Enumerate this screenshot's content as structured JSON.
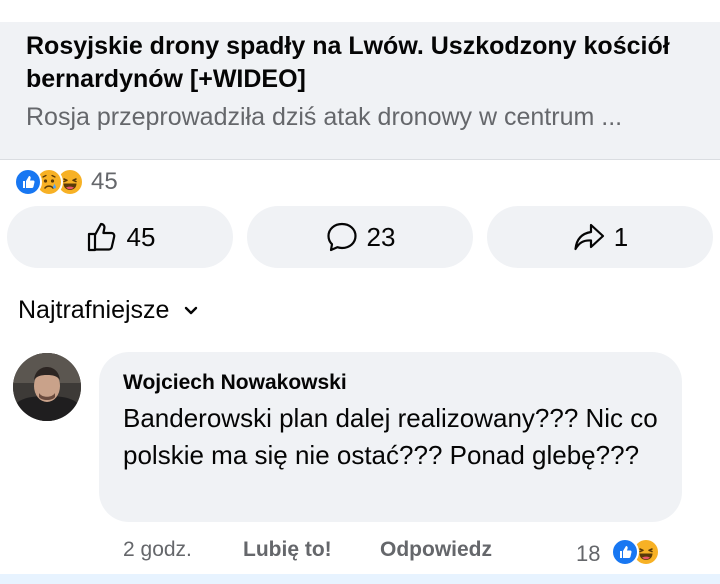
{
  "post": {
    "link_title": "Rosyjskie drony spadły na Lwów. Uszkodzony kościół bernardynów [+WIDEO]",
    "link_description": "Rosja przeprowadziła dziś atak dronowy w centrum ..."
  },
  "reactions": {
    "icons": [
      "like-icon",
      "sad-icon",
      "haha-icon"
    ],
    "count": "45"
  },
  "actions": {
    "like_count": "45",
    "comment_count": "23",
    "share_count": "1"
  },
  "sort": {
    "label": "Najtrafniejsze"
  },
  "comment": {
    "author": "Wojciech Nowakowski",
    "text": "Banderowski plan dalej realizowany??? Nic co polskie ma się nie ostać??? Ponad glebę???",
    "time": "2 godz.",
    "like_label": "Lubię to!",
    "reply_label": "Odpowiedz",
    "reaction_count": "18",
    "reaction_icons": [
      "like-icon",
      "haha-icon"
    ]
  },
  "colors": {
    "like_blue": "#1877f2",
    "emoji_yellow": "#f7b125",
    "bubble_bg": "#f0f2f5",
    "secondary_text": "#65676b"
  }
}
